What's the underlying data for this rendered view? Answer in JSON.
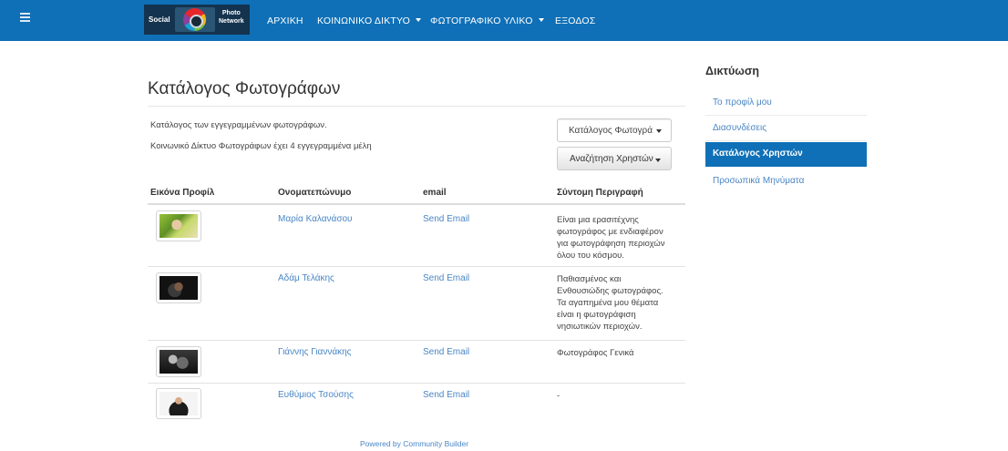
{
  "navbar": {
    "logo_text_left": "Social",
    "logo_text_right_1": "Photo",
    "logo_text_right_2": "Network",
    "items": [
      "ΑΡΧΙΚΗ",
      "ΚΟΙΝΩΝΙΚΟ ΔΙΚΤΥΟ",
      "ΦΩΤΟΓΡΑΦΙΚΟ ΥΛΙΚΟ",
      "ΕΞΟΔΟΣ"
    ],
    "color": "#0f70b7"
  },
  "main": {
    "title": "Κατάλογος Φωτογράφων",
    "description": "Κατάλογος των εγγεγραμμένων φωτογράφων.",
    "member_count_text": "Κοινωνικό Δίκτυο Φωτογράφων έχει 4 εγγεγραμμένα μέλη",
    "list_select_value": "Κατάλογος Φωτογρά",
    "search_button": "Αναζήτηση Χρηστών",
    "columns": [
      "Εικόνα Προφίλ",
      "Ονοματεπώνυμο",
      "email",
      "Σύντομη Περιγραφή"
    ],
    "rows": [
      {
        "name": "Μαρία Καλανάσου",
        "email": "Send Email",
        "bio": [
          "Είναι μια ερασιτέχνης",
          "φωτογράφος με ενδιαφέρον",
          "για φωτογράφηση περιοχών",
          "όλου του κόσμου."
        ]
      },
      {
        "name": "Αδάμ Τελάκης",
        "email": "Send Email",
        "bio": [
          "Παθιασμένος και",
          "Ενθουσιώδης φωτογράφος.",
          "Τα αγαπημένα μου θέματα",
          "είναι η φωτογράφιση",
          "νησιωτικών περιοχών."
        ]
      },
      {
        "name": "Γιάννης Γιαννάκης",
        "email": "Send Email",
        "bio": [
          "Φωτογράφος Γενικά"
        ]
      },
      {
        "name": "Ευθύμιος Τσούσης",
        "email": "Send Email",
        "bio": [
          "-"
        ]
      }
    ],
    "footer": "Powered by Community Builder",
    "link_color": "#4a86c5"
  },
  "sidebar": {
    "title": "Δικτύωση",
    "items": [
      "Το προφίλ μου",
      "Διασυνδέσεις",
      "Κατάλογος Χρηστών",
      "Προσωπικά Μηνύματα"
    ],
    "active_index": 2
  }
}
